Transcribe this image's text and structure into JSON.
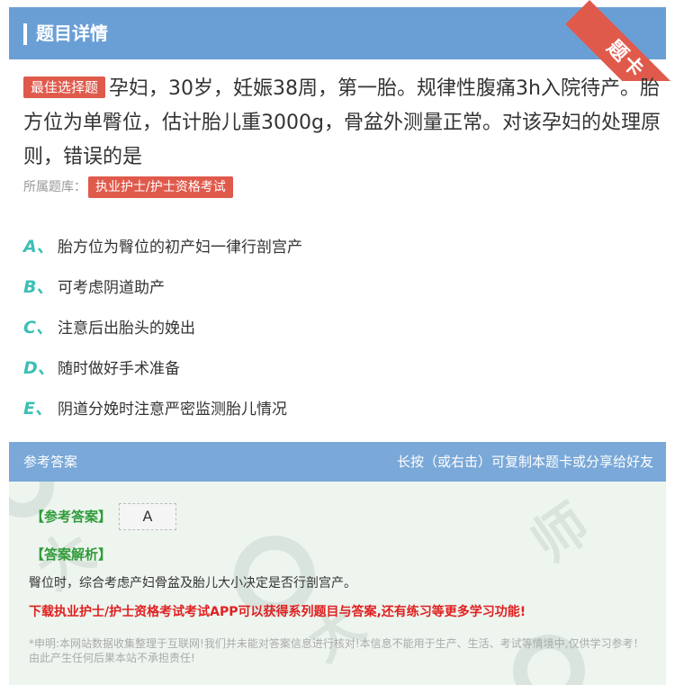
{
  "header": {
    "title": "题目详情"
  },
  "ribbon": {
    "label": "题卡"
  },
  "question": {
    "tag": "最佳选择题",
    "text": "孕妇，30岁，妊娠38周，第一胎。规律性腹痛3h入院待产。胎方位为单臀位，估计胎儿重3000g，骨盆外测量正常。对该孕妇的处理原则，错误的是"
  },
  "bank": {
    "label": "所属题库：",
    "name": "执业护士/护士资格考试"
  },
  "options": [
    {
      "letter": "A、",
      "text": "胎方位为臀位的初产妇一律行剖宫产"
    },
    {
      "letter": "B、",
      "text": "可考虑阴道助产"
    },
    {
      "letter": "C、",
      "text": "注意后出胎头的娩出"
    },
    {
      "letter": "D、",
      "text": "随时做好手术准备"
    },
    {
      "letter": "E、",
      "text": "阴道分娩时注意严密监测胎儿情况"
    }
  ],
  "answer": {
    "header_left": "参考答案",
    "header_right": "长按（或右击）可复制本题卡或分享给好友",
    "ref_label": "【参考答案】",
    "ref_value": "A",
    "analysis_label": "【答案解析】",
    "analysis_text": "臀位时，综合考虑产妇骨盆及胎儿大小决定是否行剖宫产。",
    "promo": "下载执业护士/护士资格考试考试APP可以获得系列题目与答案,还有练习等更多学习功能!",
    "disclaimer": "*申明:本网站数据收集整理于互联网!我们并未能对答案信息进行核对!本信息不能用于生产、生活、考试等情境中,仅供学习参考！由此产生任何后果本站不承担责任!"
  },
  "colors": {
    "header": "#6a9fd6",
    "accent_red": "#e05a4c",
    "option_letter": "#3cbfb5",
    "answer_green": "#2f9b3a"
  }
}
